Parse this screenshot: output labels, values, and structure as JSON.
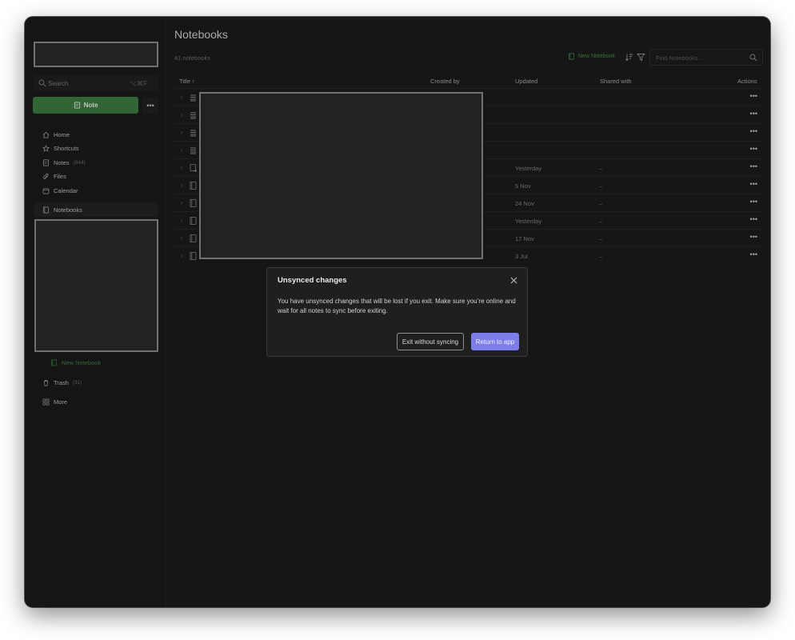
{
  "sidebar": {
    "search_label": "Search",
    "search_shortcut": "⌥⌘F",
    "note_button_label": "Note",
    "more_button_label": "•••",
    "nav": [
      {
        "label": "Home",
        "count": ""
      },
      {
        "label": "Shortcuts",
        "count": ""
      },
      {
        "label": "Notes",
        "count": "(844)"
      },
      {
        "label": "Files",
        "count": ""
      },
      {
        "label": "Calendar",
        "count": ""
      }
    ],
    "notebooks_label": "Notebooks",
    "new_notebook_label": "New Notebook",
    "trash_label": "Trash",
    "trash_count": "(91)",
    "more_label": "More"
  },
  "main": {
    "title": "Notebooks",
    "count_label": "41 notebooks",
    "new_notebook_label": "New Notebook",
    "find_placeholder": "Find Notebooks...",
    "columns": [
      "Title ↑",
      "Created by",
      "Updated",
      "Shared with",
      "Actions"
    ],
    "rows": [
      {
        "updated": "",
        "shared": ""
      },
      {
        "updated": "",
        "shared": ""
      },
      {
        "updated": "",
        "shared": ""
      },
      {
        "updated": "",
        "shared": ""
      },
      {
        "updated": "Yesterday",
        "shared": "–"
      },
      {
        "updated": "5 Nov",
        "shared": "–"
      },
      {
        "updated": "24 Nov",
        "shared": "–"
      },
      {
        "updated": "Yesterday",
        "shared": "–"
      },
      {
        "updated": "17 Nov",
        "shared": "–"
      },
      {
        "updated": "3 Jul",
        "shared": "–"
      }
    ],
    "row_action": "•••"
  },
  "dialog": {
    "title": "Unsynced changes",
    "body": "You have unsynced changes that will be lost if you exit. Make sure you’re online and wait for all notes to sync before exiting.",
    "exit_label": "Exit without syncing",
    "return_label": "Return to app"
  },
  "colors": {
    "accent_green": "#3b7a41",
    "primary_button": "#7d7dea"
  }
}
